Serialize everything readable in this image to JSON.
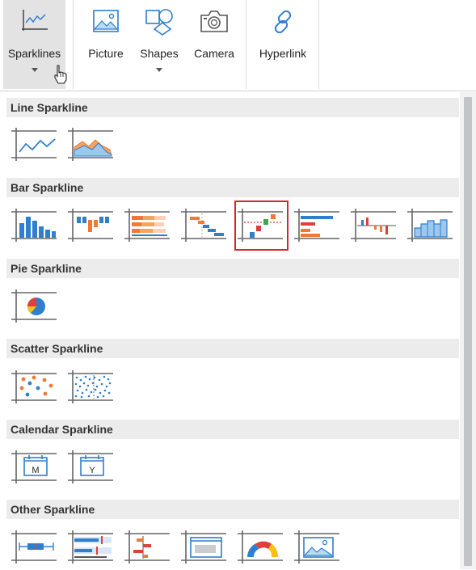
{
  "ribbon": {
    "buttons": [
      {
        "id": "sparklines",
        "label": "Sparklines"
      },
      {
        "id": "picture",
        "label": "Picture"
      },
      {
        "id": "shapes",
        "label": "Shapes"
      },
      {
        "id": "camera",
        "label": "Camera"
      },
      {
        "id": "hyperlink",
        "label": "Hyperlink"
      }
    ]
  },
  "gallery": {
    "sections": [
      {
        "title": "Line Sparkline",
        "items": [
          "line",
          "area"
        ]
      },
      {
        "title": "Bar Sparkline",
        "items": [
          "column",
          "winloss",
          "bar-stacked",
          "cascade",
          "vari",
          "horizontal-bar",
          "vari-bars",
          "stepped"
        ]
      },
      {
        "title": "Pie Sparkline",
        "items": [
          "pie"
        ]
      },
      {
        "title": "Scatter Sparkline",
        "items": [
          "scatter",
          "scatter-dense"
        ]
      },
      {
        "title": "Calendar Sparkline",
        "items": [
          "month",
          "year"
        ]
      },
      {
        "title": "Other Sparkline",
        "items": [
          "box-plot",
          "bullet",
          "spread",
          "image-thumb",
          "gauge",
          "image"
        ]
      }
    ],
    "calendar_letters": {
      "month": "M",
      "year": "Y"
    },
    "selected_item": "vari"
  },
  "colors": {
    "blue": "#2f7fce",
    "orange": "#f07a34",
    "red": "#e0403a",
    "green": "#3aa655",
    "yellow": "#f6c21a",
    "selection": "#d8262b"
  }
}
